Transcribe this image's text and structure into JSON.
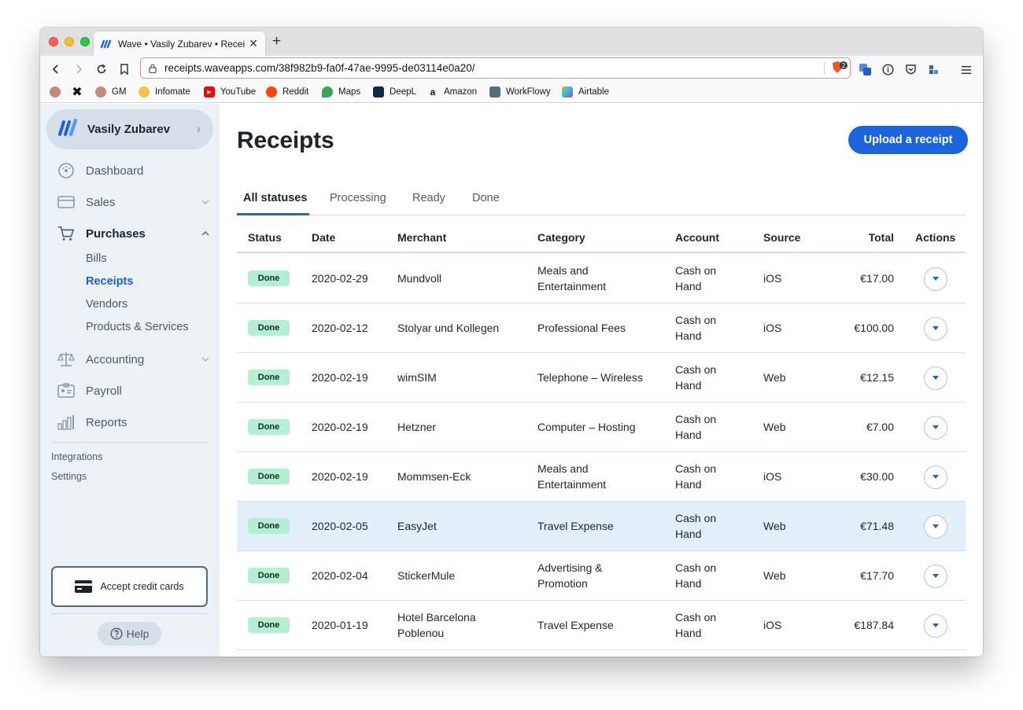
{
  "browser": {
    "tab_title": "Wave • Vasily Zubarev • Receipts",
    "url": "receipts.waveapps.com/38f982b9-fa0f-47ae-9995-de03114e0a20/",
    "shield_count": "2",
    "bookmarks": [
      {
        "label": ""
      },
      {
        "label": ""
      },
      {
        "label": "GM"
      },
      {
        "label": "Infomate"
      },
      {
        "label": "YouTube"
      },
      {
        "label": "Reddit"
      },
      {
        "label": "Maps"
      },
      {
        "label": "DeepL"
      },
      {
        "label": "Amazon"
      },
      {
        "label": "WorkFlowy"
      },
      {
        "label": "Airtable"
      }
    ]
  },
  "sidebar": {
    "business_name": "Vasily Zubarev",
    "items": [
      {
        "label": "Dashboard"
      },
      {
        "label": "Sales"
      },
      {
        "label": "Purchases"
      },
      {
        "label": "Accounting"
      },
      {
        "label": "Payroll"
      },
      {
        "label": "Reports"
      }
    ],
    "purchases_sub": [
      {
        "label": "Bills"
      },
      {
        "label": "Receipts"
      },
      {
        "label": "Vendors"
      },
      {
        "label": "Products & Services"
      }
    ],
    "links": [
      {
        "label": "Integrations"
      },
      {
        "label": "Settings"
      }
    ],
    "accept_cards_label": "Accept credit cards",
    "help_label": "Help"
  },
  "main": {
    "title": "Receipts",
    "upload_label": "Upload a receipt",
    "status_tabs": [
      {
        "label": "All statuses"
      },
      {
        "label": "Processing"
      },
      {
        "label": "Ready"
      },
      {
        "label": "Done"
      }
    ],
    "columns": {
      "status": "Status",
      "date": "Date",
      "merchant": "Merchant",
      "category": "Category",
      "account": "Account",
      "source": "Source",
      "total": "Total",
      "actions": "Actions"
    },
    "rows": [
      {
        "status": "Done",
        "date": "2020-02-29",
        "merchant": [
          "Mundvoll",
          ""
        ],
        "category": [
          "Meals and",
          "Entertainment"
        ],
        "account": [
          "Cash on",
          "Hand"
        ],
        "source": "iOS",
        "total": "€17.00"
      },
      {
        "status": "Done",
        "date": "2020-02-12",
        "merchant": [
          "Stolyar und Kollegen",
          ""
        ],
        "category": [
          "Professional Fees",
          ""
        ],
        "account": [
          "Cash on",
          "Hand"
        ],
        "source": "iOS",
        "total": "€100.00"
      },
      {
        "status": "Done",
        "date": "2020-02-19",
        "merchant": [
          "wimSIM",
          ""
        ],
        "category": [
          "Telephone – Wireless",
          ""
        ],
        "account": [
          "Cash on",
          "Hand"
        ],
        "source": "Web",
        "total": "€12.15"
      },
      {
        "status": "Done",
        "date": "2020-02-19",
        "merchant": [
          "Hetzner",
          ""
        ],
        "category": [
          "Computer – Hosting",
          ""
        ],
        "account": [
          "Cash on",
          "Hand"
        ],
        "source": "Web",
        "total": "€7.00"
      },
      {
        "status": "Done",
        "date": "2020-02-19",
        "merchant": [
          "Mommsen-Eck",
          ""
        ],
        "category": [
          "Meals and",
          "Entertainment"
        ],
        "account": [
          "Cash on",
          "Hand"
        ],
        "source": "iOS",
        "total": "€30.00"
      },
      {
        "status": "Done",
        "date": "2020-02-05",
        "merchant": [
          "EasyJet",
          ""
        ],
        "category": [
          "Travel Expense",
          ""
        ],
        "account": [
          "Cash on",
          "Hand"
        ],
        "source": "Web",
        "total": "€71.48"
      },
      {
        "status": "Done",
        "date": "2020-02-04",
        "merchant": [
          "StickerMule",
          ""
        ],
        "category": [
          "Advertising &",
          "Promotion"
        ],
        "account": [
          "Cash on",
          "Hand"
        ],
        "source": "Web",
        "total": "€17.70"
      },
      {
        "status": "Done",
        "date": "2020-01-19",
        "merchant": [
          "Hotel Barcelona",
          "Poblenou"
        ],
        "category": [
          "Travel Expense",
          ""
        ],
        "account": [
          "Cash on",
          "Hand"
        ],
        "source": "iOS",
        "total": "€187.84"
      }
    ]
  },
  "colors": {
    "accent": "#1c64db",
    "sidebar_bg": "#ecf1f5",
    "badge_done": "#b2f0d2",
    "row_highlight": "#e3eefb"
  }
}
